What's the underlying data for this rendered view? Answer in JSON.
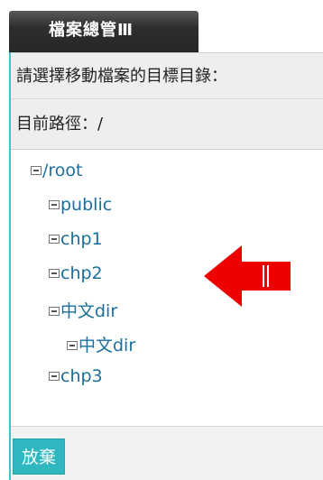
{
  "window": {
    "title": "檔案總管Ⅲ"
  },
  "dialog": {
    "prompt": "請選擇移動檔案的目標目錄：",
    "current_path": "目前路徑：/"
  },
  "tree": {
    "nodes": [
      {
        "label": "/root",
        "level": 0
      },
      {
        "label": "public",
        "level": 1
      },
      {
        "label": "chp1",
        "level": 1
      },
      {
        "label": "chp2",
        "level": 1
      },
      {
        "label": "中文dir",
        "level": 1
      },
      {
        "label": "中文dir",
        "level": 2
      },
      {
        "label": "chp3",
        "level": 1
      }
    ]
  },
  "actions": {
    "cancel_label": "放棄"
  },
  "colors": {
    "accent": "#2fb8c0",
    "link": "#1a6f9c",
    "arrow": "#ee0000"
  },
  "icons": {
    "tree_toggle": "collapse-minus-icon",
    "pointer": "left-arrow-icon"
  }
}
